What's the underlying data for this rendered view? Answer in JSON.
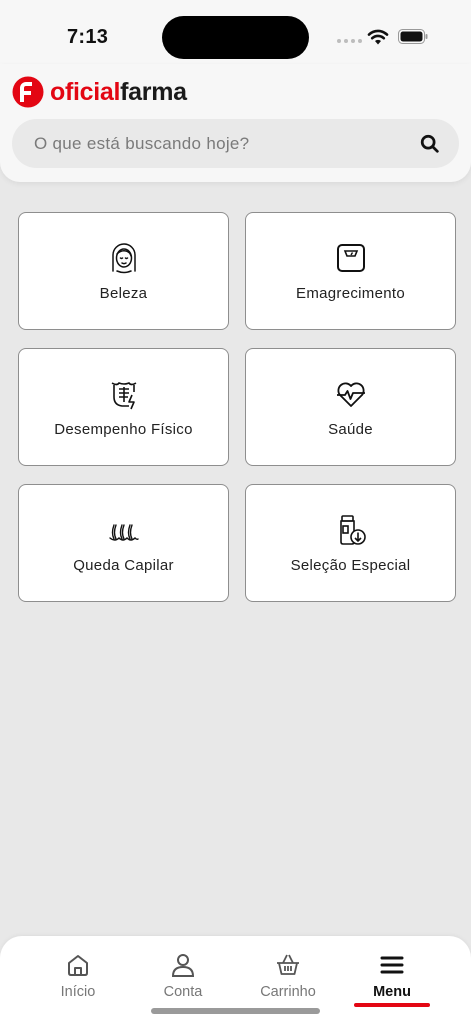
{
  "status_bar": {
    "time": "7:13"
  },
  "brand": {
    "part1": "oficial",
    "part2": "farma",
    "red": "#e30613"
  },
  "search": {
    "placeholder": "O que está buscando hoje?"
  },
  "categories": [
    {
      "label": "Beleza",
      "icon": "face-icon"
    },
    {
      "label": "Emagrecimento",
      "icon": "scale-icon"
    },
    {
      "label": "Desempenho Físico",
      "icon": "muscle-icon"
    },
    {
      "label": "Saúde",
      "icon": "heart-pulse-icon"
    },
    {
      "label": "Queda Capilar",
      "icon": "hair-icon"
    },
    {
      "label": "Seleção Especial",
      "icon": "pill-bottle-icon"
    }
  ],
  "nav": {
    "items": [
      {
        "label": "Início",
        "icon": "home-icon"
      },
      {
        "label": "Conta",
        "icon": "user-icon"
      },
      {
        "label": "Carrinho",
        "icon": "basket-icon"
      },
      {
        "label": "Menu",
        "icon": "menu-icon"
      }
    ],
    "active": "Menu"
  }
}
